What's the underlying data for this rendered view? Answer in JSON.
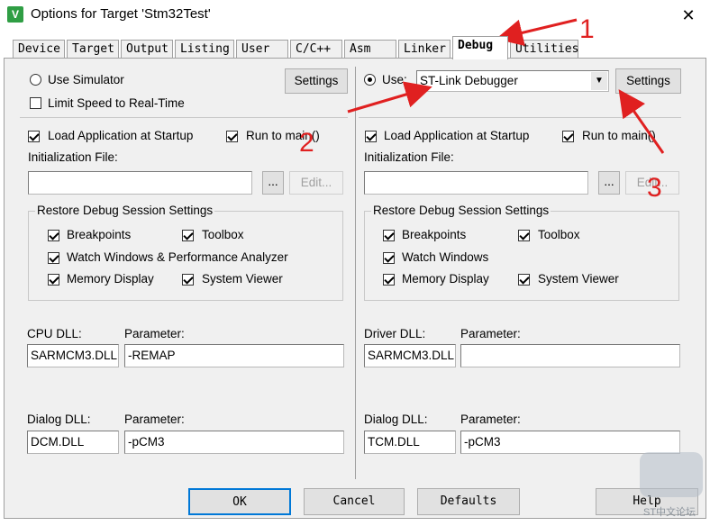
{
  "window": {
    "title": "Options for Target 'Stm32Test'",
    "icon_glyph": "V",
    "close_glyph": "✕"
  },
  "tabs": [
    "Device",
    "Target",
    "Output",
    "Listing",
    "User",
    "C/C++",
    "Asm",
    "Linker",
    "Debug",
    "Utilities"
  ],
  "active_tab": "Debug",
  "left": {
    "use_simulator": {
      "label": "Use Simulator",
      "checked": false
    },
    "limit_speed": {
      "label": "Limit Speed to Real-Time",
      "checked": false
    },
    "settings_label": "Settings",
    "load_app": {
      "label": "Load Application at Startup",
      "checked": true
    },
    "run_to_main": {
      "label": "Run to main()",
      "checked": true
    },
    "init_file_label": "Initialization File:",
    "init_file_value": "",
    "browse_label": "...",
    "edit_label": "Edit...",
    "restore_title": "Restore Debug Session Settings",
    "breakpoints": {
      "label": "Breakpoints",
      "checked": true
    },
    "toolbox": {
      "label": "Toolbox",
      "checked": true
    },
    "watch_windows": {
      "label": "Watch Windows & Performance Analyzer",
      "checked": true
    },
    "memory_display": {
      "label": "Memory Display",
      "checked": true
    },
    "system_viewer": {
      "label": "System Viewer",
      "checked": true
    },
    "cpu_dll_label": "CPU DLL:",
    "cpu_dll_value": "SARMCM3.DLL",
    "cpu_param_label": "Parameter:",
    "cpu_param_value": "-REMAP",
    "dialog_dll_label": "Dialog DLL:",
    "dialog_dll_value": "DCM.DLL",
    "dialog_param_label": "Parameter:",
    "dialog_param_value": "-pCM3"
  },
  "right": {
    "use": {
      "label": "Use:",
      "checked": true
    },
    "debugger_value": "ST-Link Debugger",
    "settings_label": "Settings",
    "load_app": {
      "label": "Load Application at Startup",
      "checked": true
    },
    "run_to_main": {
      "label": "Run to main()",
      "checked": true
    },
    "init_file_label": "Initialization File:",
    "init_file_value": "",
    "browse_label": "...",
    "edit_label": "Edit...",
    "restore_title": "Restore Debug Session Settings",
    "breakpoints": {
      "label": "Breakpoints",
      "checked": true
    },
    "toolbox": {
      "label": "Toolbox",
      "checked": true
    },
    "watch_windows": {
      "label": "Watch Windows",
      "checked": true
    },
    "memory_display": {
      "label": "Memory Display",
      "checked": true
    },
    "system_viewer": {
      "label": "System Viewer",
      "checked": true
    },
    "driver_dll_label": "Driver DLL:",
    "driver_dll_value": "SARMCM3.DLL",
    "driver_param_label": "Parameter:",
    "driver_param_value": "",
    "dialog_dll_label": "Dialog DLL:",
    "dialog_dll_value": "TCM.DLL",
    "dialog_param_label": "Parameter:",
    "dialog_param_value": "-pCM3"
  },
  "buttons": {
    "ok": "OK",
    "cancel": "Cancel",
    "defaults": "Defaults",
    "help": "Help"
  },
  "annotations": {
    "n1": "1",
    "n2": "2",
    "n3": "3",
    "color": "#e02020"
  },
  "watermark": "ST中文论坛"
}
